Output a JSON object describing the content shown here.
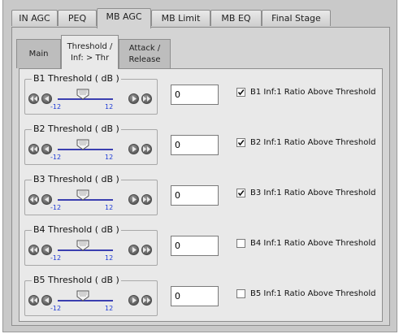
{
  "tabs": [
    {
      "label": "IN AGC",
      "active": false
    },
    {
      "label": "PEQ",
      "active": false
    },
    {
      "label": "MB AGC",
      "active": true
    },
    {
      "label": "MB Limit",
      "active": false
    },
    {
      "label": "MB EQ",
      "active": false
    },
    {
      "label": "Final Stage",
      "active": false
    }
  ],
  "subtabs": [
    {
      "label": "Main",
      "active": false
    },
    {
      "label": "Threshold /\nInf: > Thr",
      "line1": "Threshold /",
      "line2": "Inf: > Thr",
      "active": true
    },
    {
      "label": "Attack /\nRelease",
      "line1": "Attack /",
      "line2": "Release",
      "active": false
    }
  ],
  "bands": [
    {
      "title": "B1 Threshold ( dB )",
      "min": "-12",
      "max": "12",
      "value": "0",
      "check_label": "B1 Inf:1 Ratio Above Threshold",
      "checked": true
    },
    {
      "title": "B2 Threshold ( dB )",
      "min": "-12",
      "max": "12",
      "value": "0",
      "check_label": "B2 Inf:1 Ratio Above Threshold",
      "checked": true
    },
    {
      "title": "B3 Threshold ( dB )",
      "min": "-12",
      "max": "12",
      "value": "0",
      "check_label": "B3 Inf:1 Ratio Above Threshold",
      "checked": true
    },
    {
      "title": "B4 Threshold ( dB )",
      "min": "-12",
      "max": "12",
      "value": "0",
      "check_label": "B4 Inf:1 Ratio Above Threshold",
      "checked": false
    },
    {
      "title": "B5 Threshold ( dB )",
      "min": "-12",
      "max": "12",
      "value": "0",
      "check_label": "B5 Inf:1 Ratio Above Threshold",
      "checked": false
    }
  ],
  "icons": {
    "fast_left": "double-left-arrow-icon",
    "left": "left-arrow-icon",
    "right": "right-arrow-icon",
    "fast_right": "double-right-arrow-icon",
    "thumb": "slider-thumb-icon",
    "check": "checkmark-icon"
  },
  "colors": {
    "tick_label": "#1e3bd6",
    "track": "#3b3fb0"
  }
}
